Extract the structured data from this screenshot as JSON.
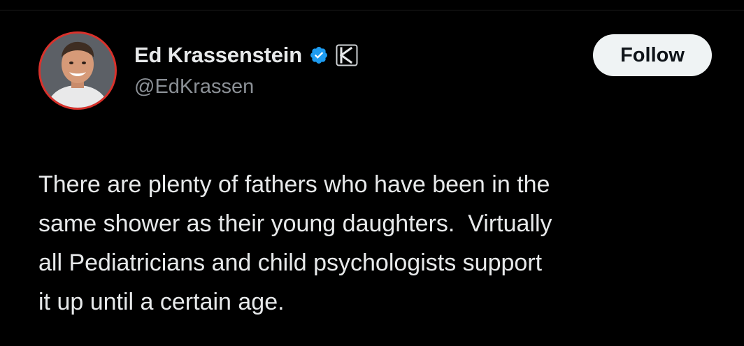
{
  "tweet": {
    "author": {
      "name": "Ed Krassenstein",
      "handle": "@EdKrassen",
      "verified_color": "#1d9bf0",
      "avatar_icon": "profile-photo",
      "affiliate_badge_icon": "k-affiliate-badge",
      "avatar_border_color": "#d9312b"
    },
    "follow_label": "Follow",
    "text_lines": [
      "There are plenty of fathers who have been in the",
      "same shower as their young daughters.  Virtually",
      "all Pediatricians and child psychologists support",
      "it up until a certain age."
    ]
  },
  "colors": {
    "background": "#000000",
    "primary_text": "#e7e9ea",
    "secondary_text": "#8b9096",
    "follow_button_bg": "#eff3f4"
  }
}
